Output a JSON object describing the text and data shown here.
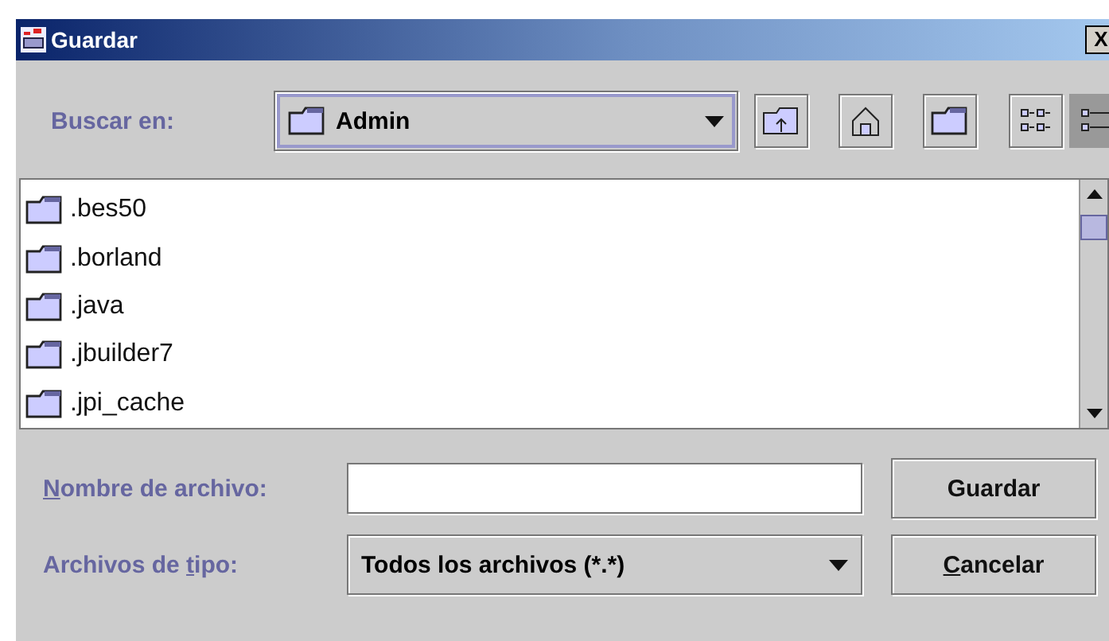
{
  "window": {
    "title": "Guardar",
    "close_label": "X"
  },
  "look_in": {
    "label": "Buscar en:",
    "value": "Admin"
  },
  "view_buttons": [
    {
      "kind": "list",
      "selected": false
    },
    {
      "kind": "details",
      "selected": true
    }
  ],
  "files": [
    {
      "name": ".bes50"
    },
    {
      "name": ".borland"
    },
    {
      "name": ".java"
    },
    {
      "name": ".jbuilder7"
    },
    {
      "name": ".jpi_cache"
    }
  ],
  "file_name": {
    "label": {
      "key": "N",
      "after": "ombre de archivo:"
    }
  },
  "file_type": {
    "label": {
      "before": "Archivos de ",
      "key": "t",
      "after": "ipo:"
    },
    "value": "Todos los archivos (*.*)"
  },
  "buttons": [
    {
      "label": {
        "before": "Guardar"
      }
    },
    {
      "label": {
        "key": "C",
        "after": "ancelar"
      }
    }
  ]
}
